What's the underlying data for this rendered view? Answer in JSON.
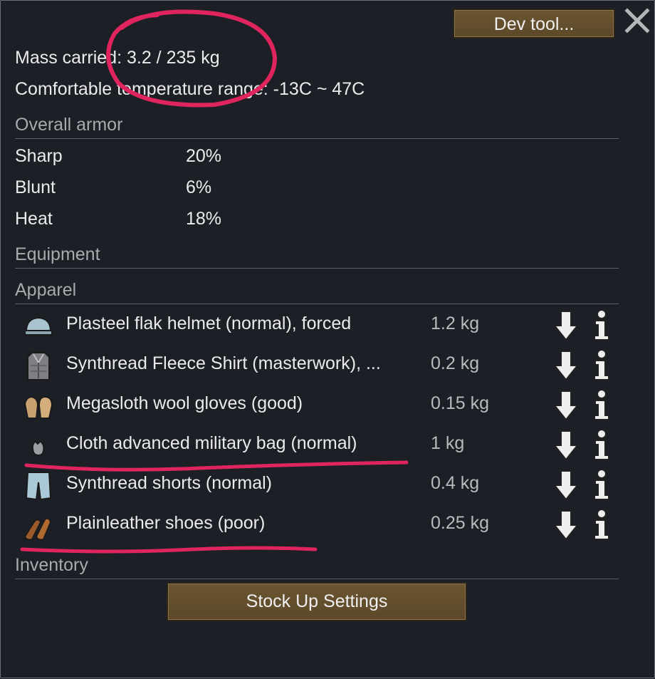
{
  "toolbar": {
    "dev_tool_label": "Dev tool..."
  },
  "stats": {
    "mass_carried": "Mass carried: 3.2 / 235 kg",
    "comfortable_temp": "Comfortable temperature range: -13C ~ 47C"
  },
  "sections": {
    "overall_armor": "Overall armor",
    "equipment": "Equipment",
    "apparel": "Apparel",
    "inventory": "Inventory"
  },
  "armor": [
    {
      "label": "Sharp",
      "value": "20%"
    },
    {
      "label": "Blunt",
      "value": "6%"
    },
    {
      "label": "Heat",
      "value": "18%"
    }
  ],
  "apparel": [
    {
      "name": "Plasteel flak helmet (normal), forced",
      "mass": "1.2 kg",
      "icon": "helmet-icon"
    },
    {
      "name": "Synthread Fleece Shirt (masterwork), ...",
      "mass": "0.2 kg",
      "icon": "shirt-icon"
    },
    {
      "name": "Megasloth wool gloves (good)",
      "mass": "0.15 kg",
      "icon": "gloves-icon"
    },
    {
      "name": "Cloth advanced military bag (normal)",
      "mass": "1 kg",
      "icon": "bag-icon"
    },
    {
      "name": "Synthread shorts (normal)",
      "mass": "0.4 kg",
      "icon": "shorts-icon"
    },
    {
      "name": "Plainleather shoes (poor)",
      "mass": "0.25 kg",
      "icon": "shoes-icon"
    }
  ],
  "buttons": {
    "stock_up": "Stock Up Settings"
  },
  "colors": {
    "background": "#1c2026",
    "button_brown": "#6b5532",
    "annotation_red": "#e0245e"
  }
}
